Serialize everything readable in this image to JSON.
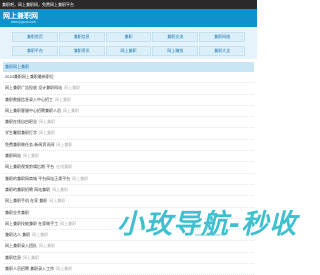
{
  "topbar": {
    "text": "兼职吧，网上兼职网，免费网上兼职平台"
  },
  "header": {
    "site_name": "网上兼职网",
    "site_url": "www.jsjzzw.com"
  },
  "nav": {
    "items": [
      {
        "label": "兼职首页"
      },
      {
        "label": "兼职信息"
      },
      {
        "label": "兼职"
      },
      {
        "label": "兼职交流"
      },
      {
        "label": "兼职网络"
      },
      {
        "label": "兼职平台"
      },
      {
        "label": "兼职资讯"
      },
      {
        "label": "网上兼职"
      },
      {
        "label": "网上赚钱"
      },
      {
        "label": "兼职大全"
      }
    ]
  },
  "breadcrumb": "兼职网上兼职",
  "list": [
    {
      "title": "2024兼职网上兼职最新职位",
      "tag": ""
    },
    {
      "title": "网上兼职广告投放 设计兼职网站",
      "tag": "网上兼职"
    },
    {
      "title": "兼职数据信息录入中心招工",
      "tag": "网上兼职"
    },
    {
      "title": "网上兼职客服中心招聘兼职人员",
      "tag": "网上兼职"
    },
    {
      "title": "兼职在线自由职业",
      "tag": "网上兼职"
    },
    {
      "title": "学生暑假兼职打字",
      "tag": "网上兼职"
    },
    {
      "title": "免费兼职做任务-新闻资讯网",
      "tag": "网上兼职"
    },
    {
      "title": "兼职网站",
      "tag": "网上兼职"
    },
    {
      "title": "网上兼职视频剪辑后期 平台",
      "tag": "在线兼职"
    },
    {
      "title": "兼职的兼职网商城 平台网站正规平台",
      "tag": "网上兼职"
    },
    {
      "title": "兼职的兼职招聘 网站兼职",
      "tag": "网上兼职"
    },
    {
      "title": "网上兼职手机 在家 兼职",
      "tag": "网上兼职"
    },
    {
      "title": "兼职业余兼职",
      "tag": ""
    },
    {
      "title": "网上兼职技能兼职 在家做手工",
      "tag": "网上兼职"
    },
    {
      "title": "兼职达人 兼职",
      "tag": "网上兼职"
    },
    {
      "title": "网上兼职录入团队",
      "tag": "网上兼职"
    },
    {
      "title": "兼职信息",
      "tag": "网上兼职"
    },
    {
      "title": "兼职人员招聘 兼职录入工作",
      "tag": "网上兼职"
    }
  ],
  "watermark": {
    "text": "小玫导航-秒收",
    "url": "www.wzdh.net"
  }
}
